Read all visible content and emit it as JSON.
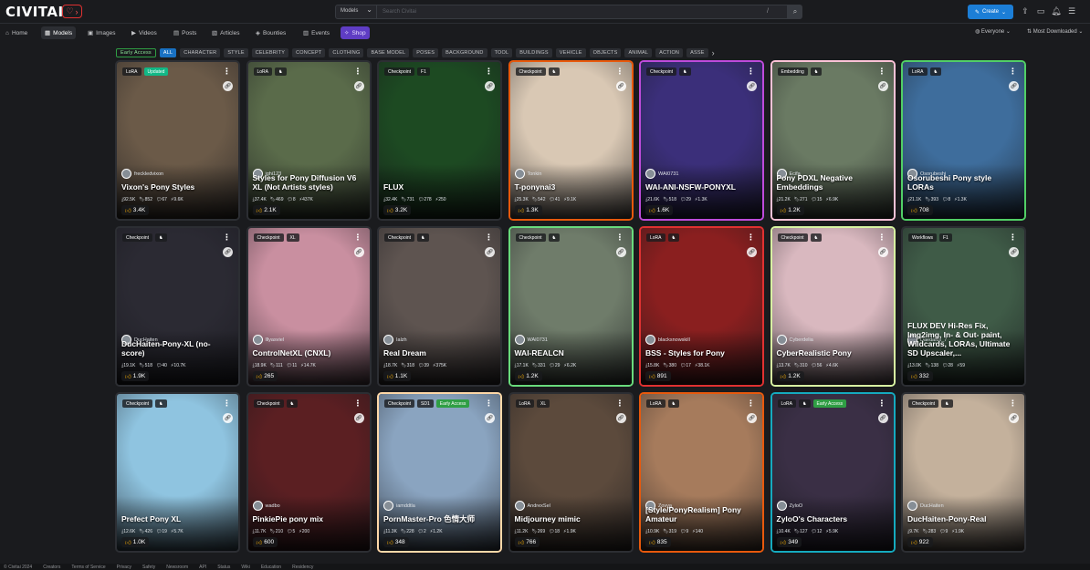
{
  "header": {
    "logo": "CIVITAI",
    "search_select": "Models",
    "search_placeholder": "Search Civitai",
    "search_shortcut": "/",
    "create_label": "Create"
  },
  "nav": {
    "items": [
      "Home",
      "Models",
      "Images",
      "Videos",
      "Posts",
      "Articles",
      "Bounties",
      "Events",
      "Shop"
    ],
    "audience": "Everyone",
    "sort": "Most Downloaded"
  },
  "chips": [
    "Early Access",
    "ALL",
    "CHARACTER",
    "STYLE",
    "CELEBRITY",
    "CONCEPT",
    "CLOTHING",
    "BASE MODEL",
    "POSES",
    "BACKGROUND",
    "TOOL",
    "BUILDINGS",
    "VEHICLE",
    "OBJECTS",
    "ANIMAL",
    "ACTION",
    "ASSE"
  ],
  "cards": [
    {
      "type": "LoRA",
      "extra": "Updated",
      "author": "freckledvixon",
      "title": "Vixon's Pony Styles",
      "stats": [
        "92.5K",
        "852",
        "67",
        "9.6K"
      ],
      "likes": "3.4K",
      "bg": "#6b5a48",
      "border": "#2c2e33"
    },
    {
      "type": "LoRA",
      "extra": "",
      "author": "ighi123",
      "title": "Styles for Pony Diffusion V6 XL (Not Artists styles)",
      "stats": [
        "37.4K",
        "469",
        "8",
        "437K"
      ],
      "likes": "2.1K",
      "bg": "#5a6b4a",
      "border": "#2c2e33"
    },
    {
      "type": "Checkpoint",
      "extra": "F1",
      "author": "",
      "title": "FLUX",
      "stats": [
        "32.4K",
        "731",
        "278",
        "250"
      ],
      "likes": "3.2K",
      "bg": "#1d4a22",
      "border": "#2c2e33"
    },
    {
      "type": "Checkpoint",
      "extra": "",
      "author": "Tonkin",
      "title": "T-ponynai3",
      "stats": [
        "25.3K",
        "542",
        "41",
        "9.1K"
      ],
      "likes": "1.3K",
      "bg": "#d9c8b4",
      "border": "#e8590c"
    },
    {
      "type": "Checkpoint",
      "extra": "",
      "author": "WAI0731",
      "title": "WAI-ANI-NSFW-PONYXL",
      "stats": [
        "21.6K",
        "518",
        "29",
        "1.3K"
      ],
      "likes": "1.6K",
      "bg": "#3b2f7a",
      "border": "#be4bdb"
    },
    {
      "type": "Embedding",
      "extra": "",
      "author": "Ecifa",
      "title": "Pony PDXL Negative Embeddings",
      "stats": [
        "21.2K",
        "271",
        "15",
        "6.9K"
      ],
      "likes": "1.2K",
      "bg": "#6a7a63",
      "border": "#fcc2d7"
    },
    {
      "type": "LoRA",
      "extra": "",
      "author": "Osorubeshi",
      "title": "Osorubeshi Pony style LORAs",
      "stats": [
        "21.1K",
        "393",
        "8",
        "1.3K"
      ],
      "likes": "708",
      "bg": "#3e6d9c",
      "border": "#51cf66"
    },
    {
      "type": "Checkpoint",
      "extra": "",
      "author": "DucHaiten",
      "title": "DucHaiten-Pony-XL (no-score)",
      "stats": [
        "19.1K",
        "518",
        "40",
        "10.7K"
      ],
      "likes": "1.9K",
      "bg": "#2b2a33",
      "border": "#2c2e33"
    },
    {
      "type": "Checkpoint",
      "extra": "XL",
      "author": "lllyasviel",
      "title": "ControlNetXL (CNXL)",
      "stats": [
        "18.9K",
        "111",
        "11",
        "14.7K"
      ],
      "likes": "265",
      "bg": "#c98fa0",
      "border": "#2c2e33"
    },
    {
      "type": "Checkpoint",
      "extra": "",
      "author": "Ialzh",
      "title": "Real Dream",
      "stats": [
        "18.7K",
        "318",
        "39",
        "375K"
      ],
      "likes": "1.1K",
      "bg": "#5e5450",
      "border": "#2c2e33"
    },
    {
      "type": "Checkpoint",
      "extra": "",
      "author": "WAI0731",
      "title": "WAI-REALCN",
      "stats": [
        "17.1K",
        "331",
        "29",
        "6.2K"
      ],
      "likes": "1.2K",
      "bg": "#6f7c6a",
      "border": "#69db7c"
    },
    {
      "type": "LoRA",
      "extra": "",
      "author": "blacksnowskill",
      "title": "BSS - Styles for Pony",
      "stats": [
        "15.8K",
        "380",
        "17",
        "38.1K"
      ],
      "likes": "891",
      "bg": "#8a1f1f",
      "border": "#e03131"
    },
    {
      "type": "Checkpoint",
      "extra": "",
      "author": "Cyberdelia",
      "title": "CyberRealistic Pony",
      "stats": [
        "13.7K",
        "310",
        "56",
        "4.6K"
      ],
      "likes": "1.2K",
      "bg": "#d9b8bf",
      "border": "#d8f5a2"
    },
    {
      "type": "Workflows",
      "extra": "F1",
      "author": "Daedalus_7",
      "title": "FLUX DEV Hi-Res Fix, Img2img, In- & Out- paint, Wildcards, LORAs, Ultimate SD Upscaler,...",
      "stats": [
        "13.0K",
        "138",
        "28",
        "59"
      ],
      "likes": "332",
      "bg": "#3f5b47",
      "border": "#2c2e33"
    },
    {
      "type": "Checkpoint",
      "extra": "",
      "author": "",
      "title": "Prefect Pony XL",
      "stats": [
        "12.6K",
        "426",
        "19",
        "5.7K"
      ],
      "likes": "1.0K",
      "bg": "#8fc4e0",
      "border": "#2c2e33"
    },
    {
      "type": "Checkpoint",
      "extra": "",
      "author": "wadbo",
      "title": "PinkiePie pony mix",
      "stats": [
        "11.7K",
        "210",
        "5",
        "200"
      ],
      "likes": "600",
      "bg": "#5b1f22",
      "border": "#2c2e33"
    },
    {
      "type": "Checkpoint",
      "extra": "SD1",
      "badge3": "Early Access",
      "author": "iamddtla",
      "title": "PornMaster-Pro 色情大师",
      "stats": [
        "11.3K",
        "228",
        "2",
        "1.2K"
      ],
      "likes": "348",
      "bg": "#8aa4c0",
      "border": "#ffd8a8"
    },
    {
      "type": "LoRA",
      "extra": "XL",
      "author": "AndrexSel",
      "title": "Midjourney mimic",
      "stats": [
        "11.2K",
        "269",
        "18",
        "1.9K"
      ],
      "likes": "766",
      "bg": "#5c4a3c",
      "border": "#2c2e33"
    },
    {
      "type": "LoRA",
      "extra": "",
      "author": "Zovya",
      "title": "[Style/PonyRealism] Pony Amateur",
      "stats": [
        "10.9K",
        "319",
        "9",
        "140"
      ],
      "likes": "835",
      "bg": "#a67b5c",
      "border": "#e8590c"
    },
    {
      "type": "LoRA",
      "extra": "",
      "badge3": "Early Access",
      "author": "ZyloO",
      "title": "ZyloO's Characters",
      "stats": [
        "10.4K",
        "127",
        "12",
        "5.9K"
      ],
      "likes": "349",
      "bg": "#3a2f45",
      "border": "#15aabf"
    },
    {
      "type": "Checkpoint",
      "extra": "",
      "author": "DucHaiten",
      "title": "DucHaiten-Pony-Real",
      "stats": [
        "9.7K",
        "283",
        "9",
        "1.9K"
      ],
      "likes": "922",
      "bg": "#c4b19c",
      "border": "#2c2e33"
    }
  ],
  "footer": [
    "Civitai 2024",
    "Creators",
    "Terms of Service",
    "Privacy",
    "Safety",
    "Newsroom",
    "API",
    "Status",
    "Wiki",
    "Education",
    "Residency"
  ]
}
